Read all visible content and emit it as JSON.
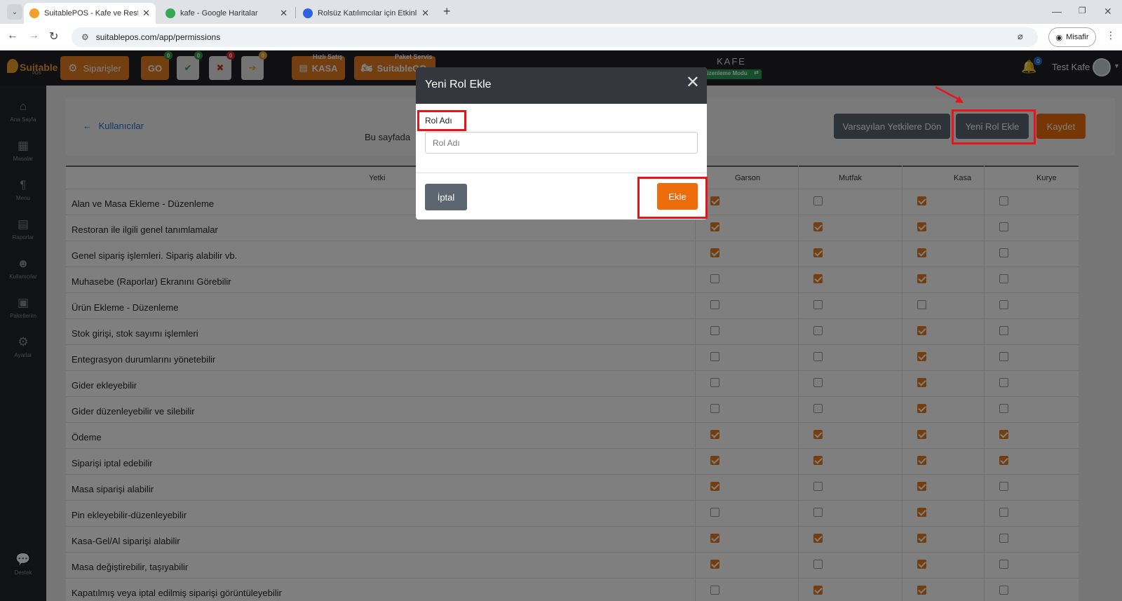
{
  "browser": {
    "tabs": [
      {
        "title": "SuitablePOS - Kafe ve Restoran",
        "active": true
      },
      {
        "title": "kafe - Google Haritalar",
        "active": false
      },
      {
        "title": "Rolsüz Katılımcılar için Etkinlik S",
        "active": false
      }
    ],
    "url": "suitablepos.com/app/permissions",
    "profile_label": "Misafir"
  },
  "topbar": {
    "logo_text": "Suitable",
    "logo_sub": "POS",
    "siparisler_label": "Siparişler",
    "go_label": "GO",
    "go_badge": "0",
    "check_badge": "0",
    "cross_badge": "0",
    "arrow_badge": "0",
    "hizli_satis_label": "Hızlı Satış",
    "kasa_label": "KASA",
    "paket_servis_label": "Paket Servis",
    "suitablego_label": "SuitableGO",
    "center_title": "KAFE",
    "mode_label": "Düzenleme Modu",
    "notif_badge": "0",
    "user_name": "Test Kafe"
  },
  "sidebar": {
    "items": [
      {
        "label": "Ana Sayfa",
        "icon": "home-icon"
      },
      {
        "label": "Masalar",
        "icon": "table-icon"
      },
      {
        "label": "Menu",
        "icon": "cutlery-icon"
      },
      {
        "label": "Raporlar",
        "icon": "report-icon"
      },
      {
        "label": "Kullanıcılar",
        "icon": "users-icon"
      },
      {
        "label": "Paketlerim",
        "icon": "gift-icon"
      },
      {
        "label": "Ayarlar",
        "icon": "gears-icon"
      }
    ],
    "support_label": "Destek"
  },
  "page": {
    "back_label": "Kullanıcılar",
    "info_text": "Bu sayfada",
    "reset_button": "Varsayılan Yetkilere Dön",
    "new_role_button": "Yeni Rol Ekle",
    "save_button": "Kaydet"
  },
  "permissions": {
    "columns": [
      "Yetki",
      "Garson",
      "Mutfak",
      "Kasa",
      "Kurye"
    ],
    "rows": [
      {
        "label": "Alan ve Masa Ekleme - Düzenleme",
        "values": [
          true,
          false,
          true,
          false
        ]
      },
      {
        "label": "Restoran ile ilgili genel tanımlamalar",
        "values": [
          true,
          true,
          true,
          false
        ]
      },
      {
        "label": "Genel sipariş işlemleri. Sipariş alabilir vb.",
        "values": [
          true,
          true,
          true,
          false
        ]
      },
      {
        "label": "Muhasebe (Raporlar) Ekranını Görebilir",
        "values": [
          false,
          true,
          true,
          false
        ]
      },
      {
        "label": "Ürün Ekleme - Düzenleme",
        "values": [
          false,
          false,
          false,
          false
        ]
      },
      {
        "label": "Stok girişi, stok sayımı işlemleri",
        "values": [
          false,
          false,
          true,
          false
        ]
      },
      {
        "label": "Entegrasyon durumlarını yönetebilir",
        "values": [
          false,
          false,
          true,
          false
        ]
      },
      {
        "label": "Gider ekleyebilir",
        "values": [
          false,
          false,
          true,
          false
        ]
      },
      {
        "label": "Gider düzenleyebilir ve silebilir",
        "values": [
          false,
          false,
          true,
          false
        ]
      },
      {
        "label": "Ödeme",
        "values": [
          true,
          true,
          true,
          true
        ]
      },
      {
        "label": "Siparişi iptal edebilir",
        "values": [
          true,
          true,
          true,
          true
        ]
      },
      {
        "label": "Masa siparişi alabilir",
        "values": [
          true,
          false,
          true,
          false
        ]
      },
      {
        "label": "Pin ekleyebilir-düzenleyebilir",
        "values": [
          false,
          false,
          true,
          false
        ]
      },
      {
        "label": "Kasa-Gel/Al siparişi alabilir",
        "values": [
          true,
          true,
          true,
          false
        ]
      },
      {
        "label": "Masa değiştirebilir, taşıyabilir",
        "values": [
          true,
          false,
          true,
          false
        ]
      },
      {
        "label": "Kapatılmış veya iptal edilmiş siparişi görüntüleyebilir",
        "values": [
          false,
          true,
          true,
          false
        ]
      }
    ]
  },
  "modal": {
    "title": "Yeni Rol Ekle",
    "field_label": "Rol Adı",
    "field_placeholder": "Rol Adı",
    "field_value": "",
    "cancel_button": "İptal",
    "add_button": "Ekle"
  },
  "colors": {
    "accent": "#ef6c0d",
    "highlight": "#e8141c",
    "dark": "#34383e"
  }
}
